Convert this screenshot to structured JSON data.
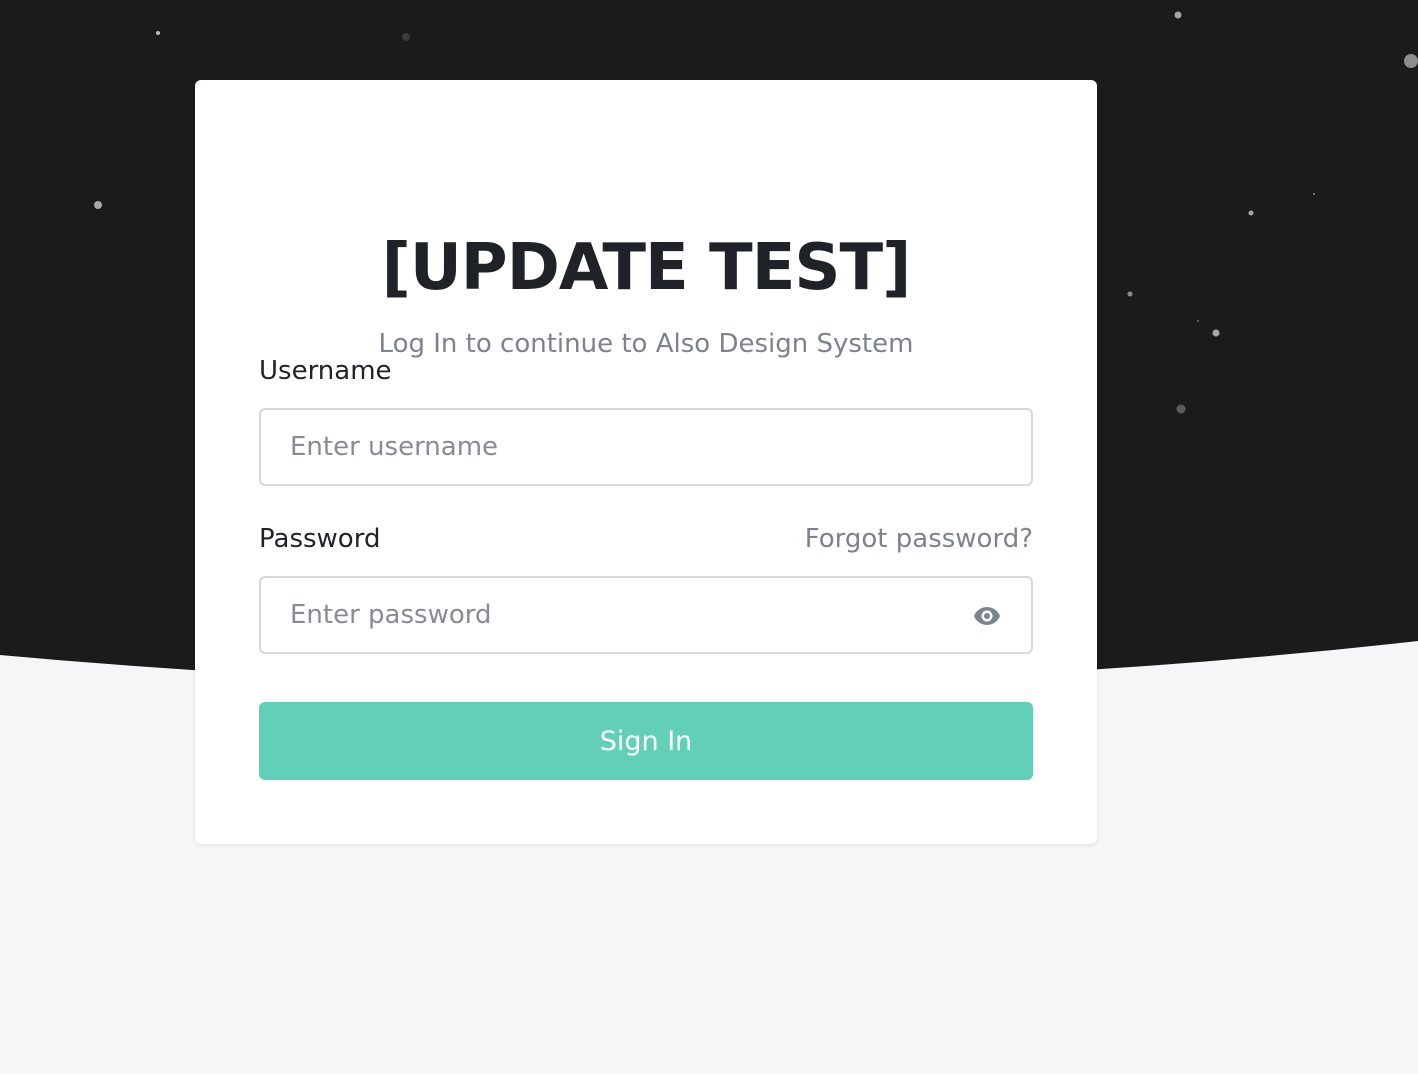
{
  "colors": {
    "dark_background": "#1b1b1c",
    "light_background": "#f5f6f8",
    "card": "#ffffff",
    "accent": "#62cfb8",
    "text_dark": "#1f2329",
    "text_muted": "#7d8290"
  },
  "login": {
    "title": "[UPDATE TEST]",
    "subtitle": "Log In to continue to Also Design System",
    "username": {
      "label": "Username",
      "placeholder": "Enter username",
      "value": ""
    },
    "password": {
      "label": "Password",
      "placeholder": "Enter password",
      "value": "",
      "toggle_icon": "eye-icon"
    },
    "forgot_password": "Forgot password?",
    "sign_in_label": "Sign In"
  }
}
